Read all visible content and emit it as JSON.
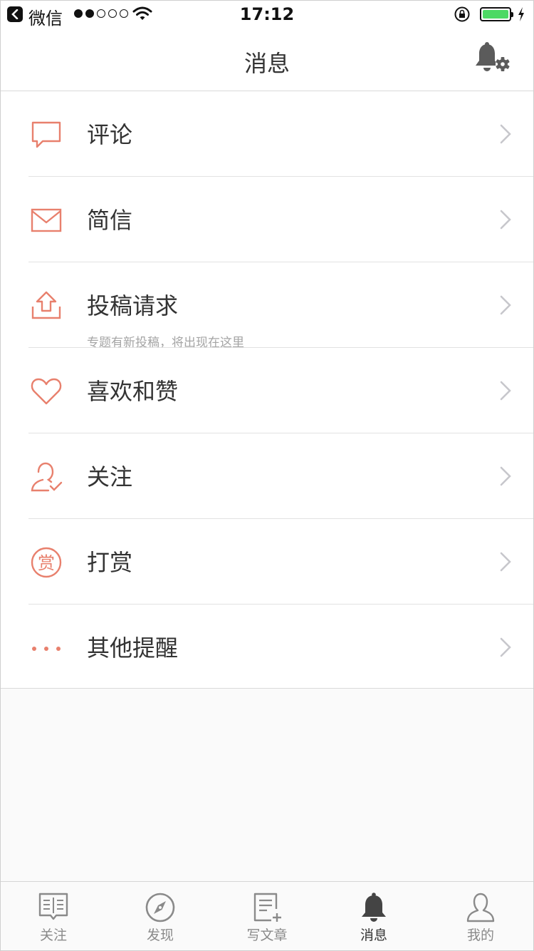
{
  "status_bar": {
    "app_name": "微信",
    "time": "17:12",
    "signal_bars_filled": 2,
    "signal_bars_total": 5,
    "battery_color": "#4cd964"
  },
  "header": {
    "title": "消息",
    "right_icon": "bell-settings-icon"
  },
  "accent_color": "#e8806d",
  "list": {
    "items": [
      {
        "label": "评论",
        "icon": "comment-icon"
      },
      {
        "label": "简信",
        "icon": "envelope-icon"
      },
      {
        "label": "投稿请求",
        "sublabel": "专题有新投稿，将出现在这里",
        "icon": "upload-icon"
      },
      {
        "label": "喜欢和赞",
        "icon": "heart-icon"
      },
      {
        "label": "关注",
        "icon": "user-check-icon"
      },
      {
        "label": "打赏",
        "icon": "reward-icon",
        "icon_text": "赏"
      },
      {
        "label": "其他提醒",
        "icon": "more-dots-icon"
      }
    ]
  },
  "tabbar": {
    "tabs": [
      {
        "label": "关注",
        "icon": "book-icon"
      },
      {
        "label": "发现",
        "icon": "compass-icon"
      },
      {
        "label": "写文章",
        "icon": "write-document-icon"
      },
      {
        "label": "消息",
        "icon": "bell-icon",
        "active": true
      },
      {
        "label": "我的",
        "icon": "person-icon"
      }
    ]
  }
}
